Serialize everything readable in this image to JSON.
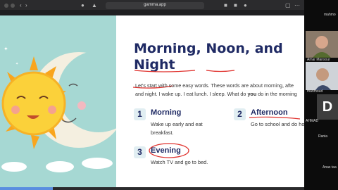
{
  "browser": {
    "url": "gamma.app"
  },
  "slide": {
    "title_part1": "Morning,",
    "title_part2": "Noon,",
    "title_part3": "and",
    "title_part4": "Night",
    "intro_line1": "Let's start with some easy words. These words are about morning, afte",
    "intro_line2_pre": "and night. I wake up. I eat lunch. I sleep. What do",
    "intro_line2_bold": "you",
    "intro_line2_post": "do in the morning",
    "items": [
      {
        "number": "1",
        "title": "Morning",
        "desc_line1": "Wake up early and eat",
        "desc_line2": "breakfast."
      },
      {
        "number": "2",
        "title": "Afternoon",
        "desc_line1": "Go to school and do ho",
        "desc_line2": ""
      },
      {
        "number": "3",
        "title": "Evening",
        "desc_line1": "Watch TV and go to bed.",
        "desc_line2": ""
      }
    ]
  },
  "participants": {
    "top_label": "mahmo",
    "tile1_label": "Amar Mansour",
    "tile2_label": "mahmoud",
    "tile3_letter": "D",
    "tile3_label": "AHMAD",
    "tile4_label": "Rania",
    "tile5_label": "Anas taa"
  },
  "colors": {
    "slide_accent_left": "#a6d8d3",
    "title_navy": "#1f2a64",
    "annotation_red": "#e0322e"
  }
}
